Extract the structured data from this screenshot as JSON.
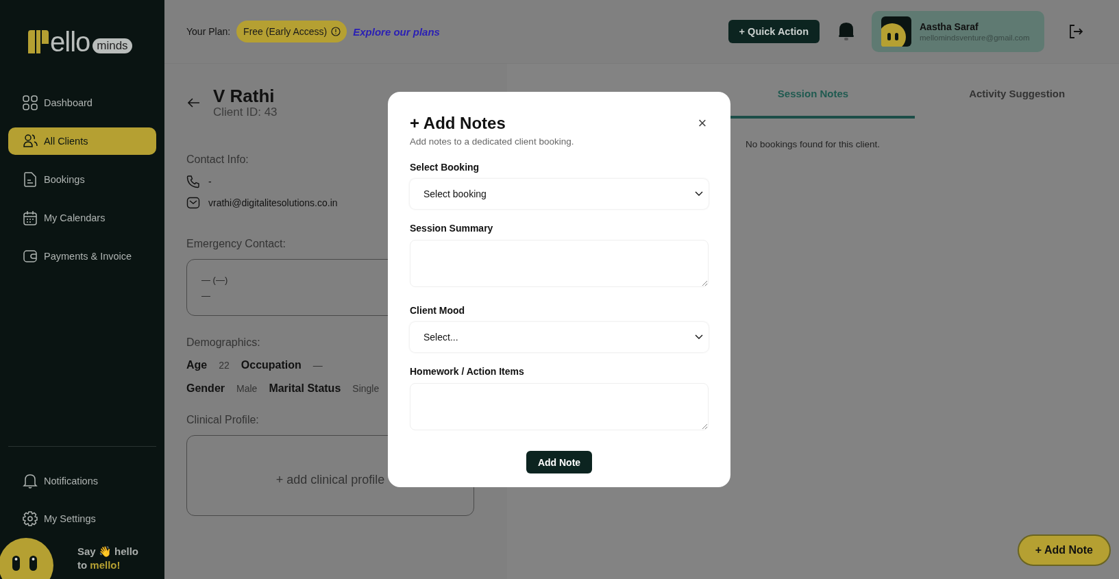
{
  "sidebar": {
    "logo": {
      "word": "ello",
      "tag": "minds"
    },
    "items": [
      {
        "label": "Dashboard",
        "selected": false
      },
      {
        "label": "All Clients",
        "selected": true
      },
      {
        "label": "Bookings",
        "selected": false
      },
      {
        "label": "My Calendars",
        "selected": false
      },
      {
        "label": "Payments & Invoice",
        "selected": false
      }
    ],
    "bottom_items": [
      {
        "label": "Notifications"
      },
      {
        "label": "My Settings"
      }
    ],
    "greeting": {
      "line1": "Say 👋 hello",
      "line2_prefix": "to",
      "line2_highlight": "mello!"
    }
  },
  "header": {
    "plan_label": "Your Plan:",
    "plan": "Free (Early Access)",
    "plans_link": "Explore our plans",
    "quick_action": "+ Quick Action",
    "user": {
      "name": "Aastha Saraf",
      "email": "mellomindsventure@gmail.com"
    }
  },
  "client": {
    "name": "V Rathi",
    "client_id": "Client ID: 43",
    "contact_heading": "Contact Info:",
    "phone": "-",
    "email": "vrathi@digitalitesolutions.co.in",
    "emergency_heading": "Emergency Contact:",
    "emergency_lines": [
      "— (—)",
      "—"
    ],
    "demographics_heading": "Demographics:",
    "demographics": [
      [
        {
          "label": "Age",
          "value": "22"
        },
        {
          "label": "Occupation",
          "value": "—"
        }
      ],
      [
        {
          "label": "Gender",
          "value": "Male"
        },
        {
          "label": "Marital Status",
          "value": "Single"
        }
      ]
    ],
    "clinical_heading": "Clinical Profile:",
    "clinical_add": "+ add clinical profile"
  },
  "tabs": [
    {
      "label": "Session Notes",
      "selected": true
    },
    {
      "label": "Activity Suggestion",
      "selected": false
    }
  ],
  "empty_message": "No bookings found for this client.",
  "add_note_button": "+ Add Note",
  "modal": {
    "title": "+ Add Notes",
    "subtitle": "Add notes to a dedicated client booking.",
    "close": "×",
    "fields": [
      {
        "label": "Select Booking",
        "kind": "select",
        "value": "Select booking"
      },
      {
        "label": "Session Summary",
        "kind": "textarea"
      },
      {
        "label": "Client Mood",
        "kind": "select",
        "value": "Select..."
      },
      {
        "label": "Homework / Action Items",
        "kind": "textarea"
      }
    ],
    "submit": "Add Note"
  }
}
